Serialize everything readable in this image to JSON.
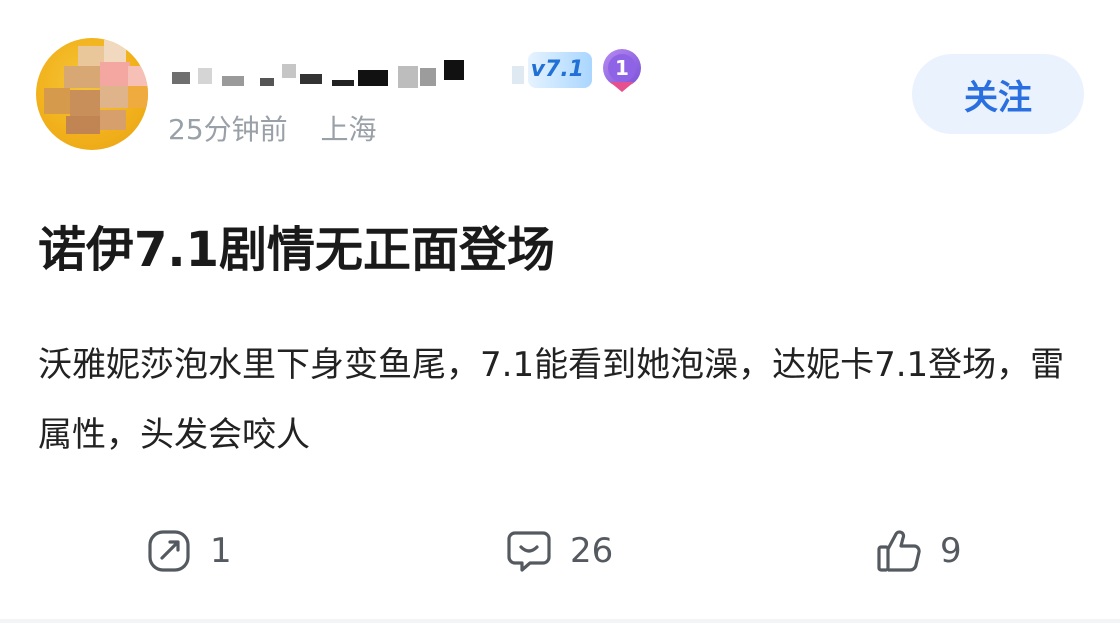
{
  "author": {
    "level_badge": "v7.1",
    "medal_number": "1",
    "time": "25分钟前",
    "location": "上海"
  },
  "header": {
    "follow_label": "关注"
  },
  "post": {
    "title": "诺伊7.1剧情无正面登场",
    "body": "沃雅妮莎泡水里下身变鱼尾，7.1能看到她泡澡，达妮卡7.1登场，雷属性，头发会咬人"
  },
  "actions": {
    "share_count": "1",
    "comment_count": "26",
    "like_count": "9"
  },
  "colors": {
    "accent": "#2a6fe0",
    "follow_bg": "#eaf2fd",
    "meta_text": "#9aa0a8",
    "title_text": "#1a1a1a"
  },
  "icons": {
    "share": "share-icon",
    "comment": "comment-icon",
    "like": "thumbs-up-icon",
    "medal": "medal-icon"
  }
}
